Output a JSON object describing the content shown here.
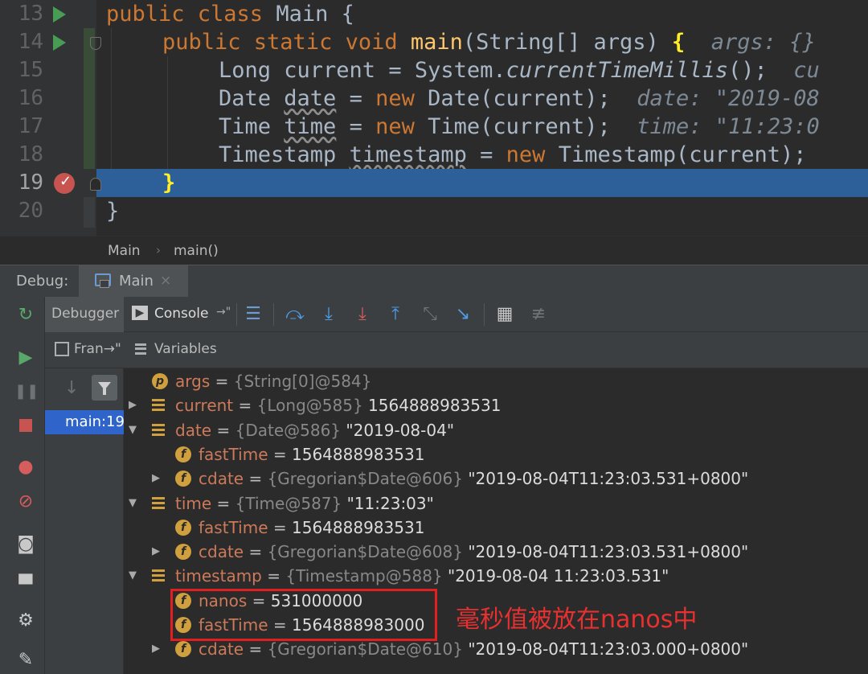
{
  "editor": {
    "lines": [
      {
        "num": "13",
        "code": {
          "kw1": "public class",
          "name": " Main {"
        }
      },
      {
        "num": "14",
        "code": {
          "kw1": "public static void",
          "fn": "main",
          "rest": "(String[] args) ",
          "brace": "{",
          "hint": "  args: {}"
        }
      },
      {
        "num": "15",
        "code": {
          "a": "Long current = System.",
          "it": "currentTimeMillis",
          "b": "();",
          "hint": "  cu"
        }
      },
      {
        "num": "16",
        "code": {
          "a": "Date ",
          "var": "date",
          "b": " = ",
          "kw": "new",
          "c": " Date(current);",
          "hint": "  date: \"2019-08"
        }
      },
      {
        "num": "17",
        "code": {
          "a": "Time ",
          "var": "time",
          "b": " = ",
          "kw": "new",
          "c": " Time(current);",
          "hint": "  time: \"11:23:0"
        }
      },
      {
        "num": "18",
        "code": {
          "a": "Timestamp ",
          "var": "timestamp",
          "b": " = ",
          "kw": "new",
          "c": " Timestamp(current);"
        }
      },
      {
        "num": "19",
        "code": {
          "brace": "}"
        }
      },
      {
        "num": "20",
        "code": {
          "a": "}"
        }
      }
    ]
  },
  "breadcrumb": {
    "items": [
      "Main",
      "main()"
    ],
    "separator": "›"
  },
  "debug": {
    "title": "Debug:",
    "tab_label": "Main",
    "tab_close": "×",
    "toolbar": {
      "debugger_tab": "Debugger",
      "console_tab": "Console",
      "console_pin": "→\"",
      "console_icon": "▶"
    },
    "frames_header": "Fran→\"",
    "variables_header": "Variables",
    "frame_item": "main:19",
    "variables": [
      {
        "indent": 0,
        "expand": "",
        "icon": "p",
        "name": "args",
        "type": "{String[0]@584}",
        "value": ""
      },
      {
        "indent": 0,
        "expand": "▶",
        "icon": "list",
        "name": "current",
        "type": "{Long@585}",
        "value": "1564888983531"
      },
      {
        "indent": 0,
        "expand": "▼",
        "icon": "list",
        "name": "date",
        "type": "{Date@586}",
        "value": "\"2019-08-04\""
      },
      {
        "indent": 1,
        "expand": "",
        "icon": "f",
        "name": "fastTime",
        "type": "",
        "value": "1564888983531"
      },
      {
        "indent": 1,
        "expand": "▶",
        "icon": "f",
        "name": "cdate",
        "type": "{Gregorian$Date@606}",
        "value": "\"2019-08-04T11:23:03.531+0800\""
      },
      {
        "indent": 0,
        "expand": "▼",
        "icon": "list",
        "name": "time",
        "type": "{Time@587}",
        "value": "\"11:23:03\""
      },
      {
        "indent": 1,
        "expand": "",
        "icon": "f",
        "name": "fastTime",
        "type": "",
        "value": "1564888983531"
      },
      {
        "indent": 1,
        "expand": "▶",
        "icon": "f",
        "name": "cdate",
        "type": "{Gregorian$Date@608}",
        "value": "\"2019-08-04T11:23:03.531+0800\""
      },
      {
        "indent": 0,
        "expand": "▼",
        "icon": "list",
        "name": "timestamp",
        "type": "{Timestamp@588}",
        "value": "\"2019-08-04 11:23:03.531\""
      },
      {
        "indent": 1,
        "expand": "",
        "icon": "f",
        "name": "nanos",
        "type": "",
        "value": "531000000"
      },
      {
        "indent": 1,
        "expand": "",
        "icon": "f",
        "name": "fastTime",
        "type": "",
        "value": "1564888983000"
      },
      {
        "indent": 1,
        "expand": "▶",
        "icon": "f",
        "name": "cdate",
        "type": "{Gregorian$Date@610}",
        "value": "\"2019-08-04T11:23:03.000+0800\""
      }
    ]
  },
  "annotation": {
    "text": "毫秒值被放在nanos中",
    "color": "#e83030"
  },
  "colors": {
    "keyword": "#cc7832",
    "function": "#ffc66d",
    "selection": "#2d6099",
    "frame_selected": "#2f65ca",
    "var_name": "#cc7a5a",
    "icon_gold": "#d09f3e"
  },
  "icons": {
    "gutter": [
      "run-icon",
      "run-icon",
      "breakpoint-icon"
    ],
    "left_toolbar": [
      "rerun-icon",
      "resume-icon",
      "pause-icon",
      "stop-icon",
      "view-breakpoints-icon",
      "mute-breakpoints-icon",
      "camera-icon",
      "layout-icon",
      "settings-icon",
      "pin-icon"
    ],
    "top_toolbar": [
      "menu-icon",
      "show-execution-point-icon",
      "step-over-icon",
      "step-into-icon",
      "force-step-into-icon",
      "step-out-icon",
      "drop-frame-icon",
      "run-to-cursor-icon",
      "evaluate-icon",
      "trace-icon"
    ]
  }
}
